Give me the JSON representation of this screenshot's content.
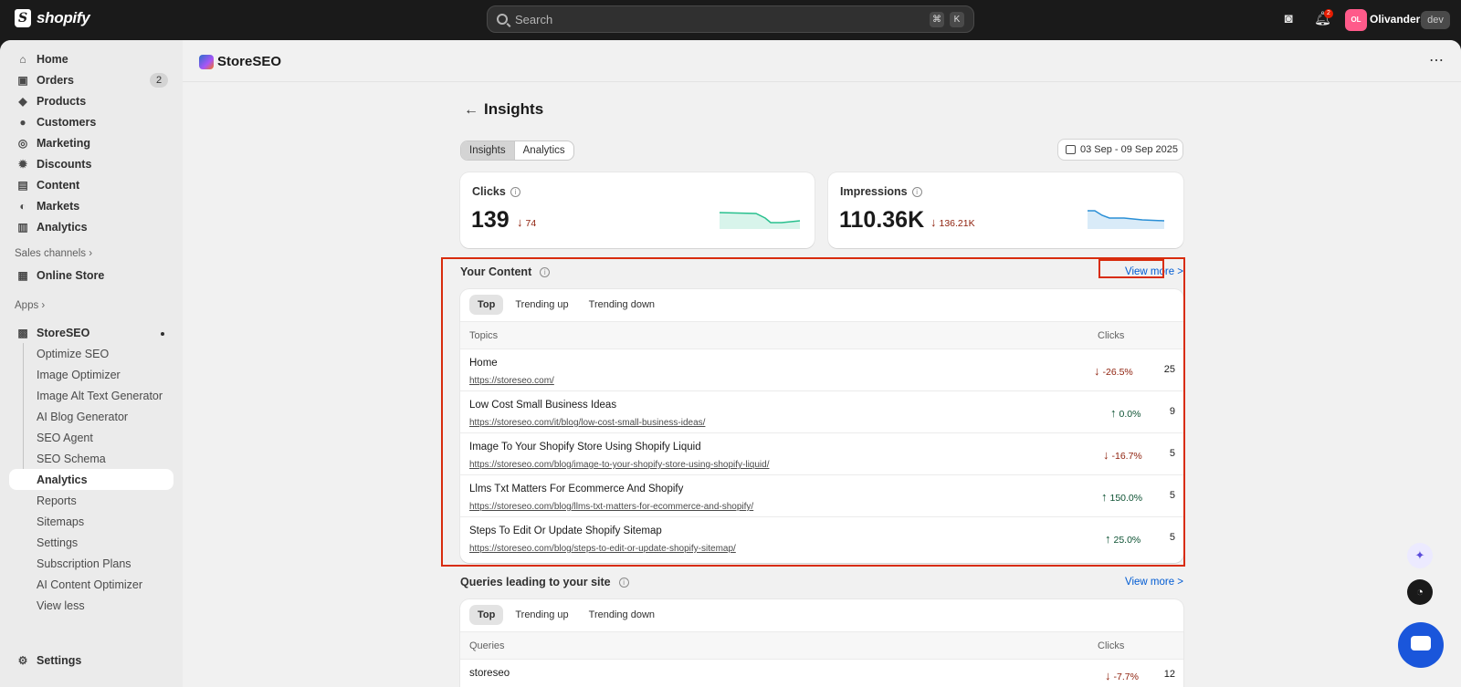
{
  "topbar": {
    "brand": "shopify",
    "search_placeholder": "Search",
    "shortcut_keys": [
      "⌘",
      "K"
    ],
    "notification_count": "2",
    "avatar_initials": "OL",
    "store_name": "Olivanders",
    "store_badge": "dev"
  },
  "sidebar": {
    "main_items": [
      {
        "label": "Home",
        "icon": "home-icon"
      },
      {
        "label": "Orders",
        "icon": "orders-icon",
        "badge": "2"
      },
      {
        "label": "Products",
        "icon": "tag-icon"
      },
      {
        "label": "Customers",
        "icon": "person-icon"
      },
      {
        "label": "Marketing",
        "icon": "target-icon"
      },
      {
        "label": "Discounts",
        "icon": "discount-icon"
      },
      {
        "label": "Content",
        "icon": "content-icon"
      },
      {
        "label": "Markets",
        "icon": "globe-icon"
      },
      {
        "label": "Analytics",
        "icon": "bar-chart-icon"
      }
    ],
    "sales_channels_label": "Sales channels",
    "online_store_label": "Online Store",
    "apps_label": "Apps",
    "app_name": "StoreSEO",
    "app_sub_items": [
      "Optimize SEO",
      "Image Optimizer",
      "Image Alt Text Generator",
      "AI Blog Generator",
      "SEO Agent",
      "SEO Schema",
      "Analytics",
      "Reports",
      "Sitemaps",
      "Settings",
      "Subscription Plans",
      "AI Content Optimizer",
      "View less"
    ],
    "active_sub_item": "Analytics",
    "settings_label": "Settings"
  },
  "app_header": {
    "title": "StoreSEO"
  },
  "page": {
    "title": "Insights",
    "segments": [
      "Insights",
      "Analytics"
    ],
    "date_range": "03 Sep - 09 Sep 2025",
    "metrics": [
      {
        "label": "Clicks",
        "value": "139",
        "delta": "74",
        "direction": "down",
        "color": "#29c08e"
      },
      {
        "label": "Impressions",
        "value": "110.36K",
        "delta": "136.21K",
        "direction": "down",
        "color": "#2a8fd6"
      }
    ],
    "your_content": {
      "title": "Your Content",
      "view_more": "View more >",
      "tabs": [
        "Top",
        "Trending up",
        "Trending down"
      ],
      "columns": [
        "Topics",
        "Clicks"
      ],
      "rows": [
        {
          "title": "Home",
          "url": "https://storeseo.com/",
          "change": "-26.5%",
          "direction": "down",
          "clicks": "25"
        },
        {
          "title": "Low Cost Small Business Ideas",
          "url": "https://storeseo.com/it/blog/low-cost-small-business-ideas/",
          "change": "0.0%",
          "direction": "up",
          "clicks": "9"
        },
        {
          "title": "Image To Your Shopify Store Using Shopify Liquid",
          "url": "https://storeseo.com/blog/image-to-your-shopify-store-using-shopify-liquid/",
          "change": "-16.7%",
          "direction": "down",
          "clicks": "5"
        },
        {
          "title": "Llms Txt Matters For Ecommerce And Shopify",
          "url": "https://storeseo.com/blog/llms-txt-matters-for-ecommerce-and-shopify/",
          "change": "150.0%",
          "direction": "up",
          "clicks": "5"
        },
        {
          "title": "Steps To Edit Or Update Shopify Sitemap",
          "url": "https://storeseo.com/blog/steps-to-edit-or-update-shopify-sitemap/",
          "change": "25.0%",
          "direction": "up",
          "clicks": "5"
        }
      ]
    },
    "queries": {
      "title": "Queries leading to your site",
      "view_more": "View more >",
      "tabs": [
        "Top",
        "Trending up",
        "Trending down"
      ],
      "columns": [
        "Queries",
        "Clicks"
      ],
      "rows": [
        {
          "title": "storeseo",
          "change": "-7.7%",
          "direction": "down",
          "clicks": "12"
        }
      ]
    }
  }
}
